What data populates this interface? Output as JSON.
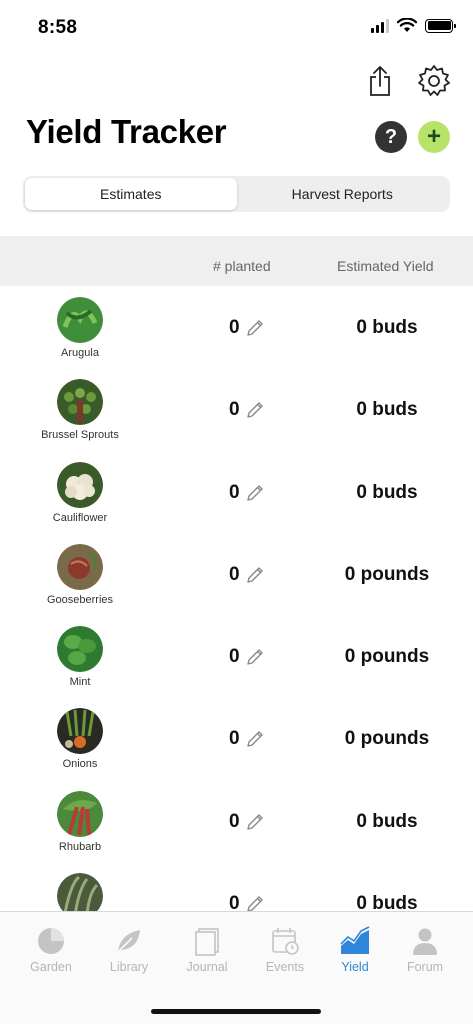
{
  "status": {
    "time": "8:58"
  },
  "header": {
    "title": "Yield Tracker",
    "help_label": "?",
    "add_label": "+"
  },
  "segments": [
    {
      "label": "Estimates",
      "active": true
    },
    {
      "label": "Harvest Reports",
      "active": false
    }
  ],
  "columns": {
    "planted": "# planted",
    "yield": "Estimated Yield"
  },
  "rows": [
    {
      "name": "Arugula",
      "planted": "0",
      "yield": "0 buds",
      "color": "#3f8e3a"
    },
    {
      "name": "Brussel Sprouts",
      "planted": "0",
      "yield": "0 buds",
      "color": "#3b5a2a"
    },
    {
      "name": "Cauliflower",
      "planted": "0",
      "yield": "0 buds",
      "color": "#e8e2cf"
    },
    {
      "name": "Gooseberries",
      "planted": "0",
      "yield": "0 pounds",
      "color": "#8a4a3a"
    },
    {
      "name": "Mint",
      "planted": "0",
      "yield": "0 pounds",
      "color": "#3a8a3a"
    },
    {
      "name": "Onions",
      "planted": "0",
      "yield": "0 pounds",
      "color": "#2e3a2a"
    },
    {
      "name": "Rhubarb",
      "planted": "0",
      "yield": "0 buds",
      "color": "#4a8a3a"
    },
    {
      "name": "",
      "planted": "0",
      "yield": "0 buds",
      "color": "#5a6a4a"
    }
  ],
  "tabs": [
    {
      "label": "Garden",
      "icon": "pie-chart-icon",
      "active": false
    },
    {
      "label": "Library",
      "icon": "leaf-icon",
      "active": false
    },
    {
      "label": "Journal",
      "icon": "journal-icon",
      "active": false
    },
    {
      "label": "Events",
      "icon": "calendar-clock-icon",
      "active": false
    },
    {
      "label": "Yield",
      "icon": "yield-chart-icon",
      "active": true
    },
    {
      "label": "Forum",
      "icon": "person-icon",
      "active": false
    }
  ],
  "colors": {
    "accent": "#2f86d9",
    "add_button": "#b8e26a",
    "inactive_tab": "#b5b5b5"
  }
}
